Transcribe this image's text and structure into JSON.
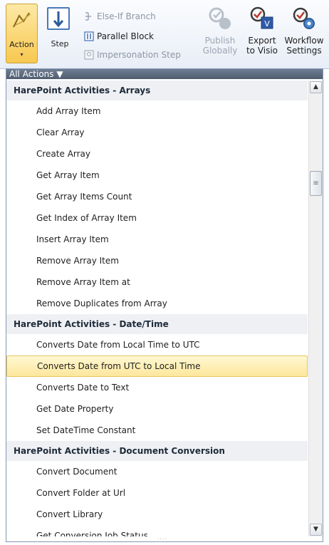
{
  "ribbon": {
    "action_label": "Action",
    "action_arrow": "▾",
    "step_label": "Step",
    "small_buttons": [
      {
        "label": "Else-If Branch",
        "icon": "else-if-icon",
        "disabled": true
      },
      {
        "label": "Parallel Block",
        "icon": "parallel-block-icon",
        "disabled": false
      },
      {
        "label": "Impersonation Step",
        "icon": "impersonation-icon",
        "disabled": true
      }
    ],
    "publish_label_1": "Publish",
    "publish_label_2": "Globally",
    "export_label_1": "Export",
    "export_label_2": "to Visio",
    "workflow_label_1": "Workflow",
    "workflow_label_2": "Settings"
  },
  "panel": {
    "filter_label": "All Actions ▼",
    "groups": [
      {
        "title": "HarePoint Activities - Arrays",
        "items": [
          "Add Array Item",
          "Clear Array",
          "Create Array",
          "Get Array Item",
          "Get Array Items Count",
          "Get Index of Array Item",
          "Insert Array Item",
          "Remove Array Item",
          "Remove Array Item at",
          "Remove Duplicates from Array"
        ]
      },
      {
        "title": "HarePoint Activities - Date/Time",
        "items": [
          "Converts Date from Local Time to UTC",
          "Converts Date from UTC to Local Time",
          "Converts Date to Text",
          "Get Date Property",
          "Set DateTime Constant"
        ]
      },
      {
        "title": "HarePoint Activities - Document Conversion",
        "items": [
          "Convert Document",
          "Convert Folder at Url",
          "Convert Library",
          "Get Conversion Job Status"
        ]
      }
    ],
    "selected_item": "Converts Date from UTC to Local Time"
  },
  "colors": {
    "accent": "#f8c850",
    "selection": "#fde79d",
    "filter_bar": "#505d71"
  }
}
